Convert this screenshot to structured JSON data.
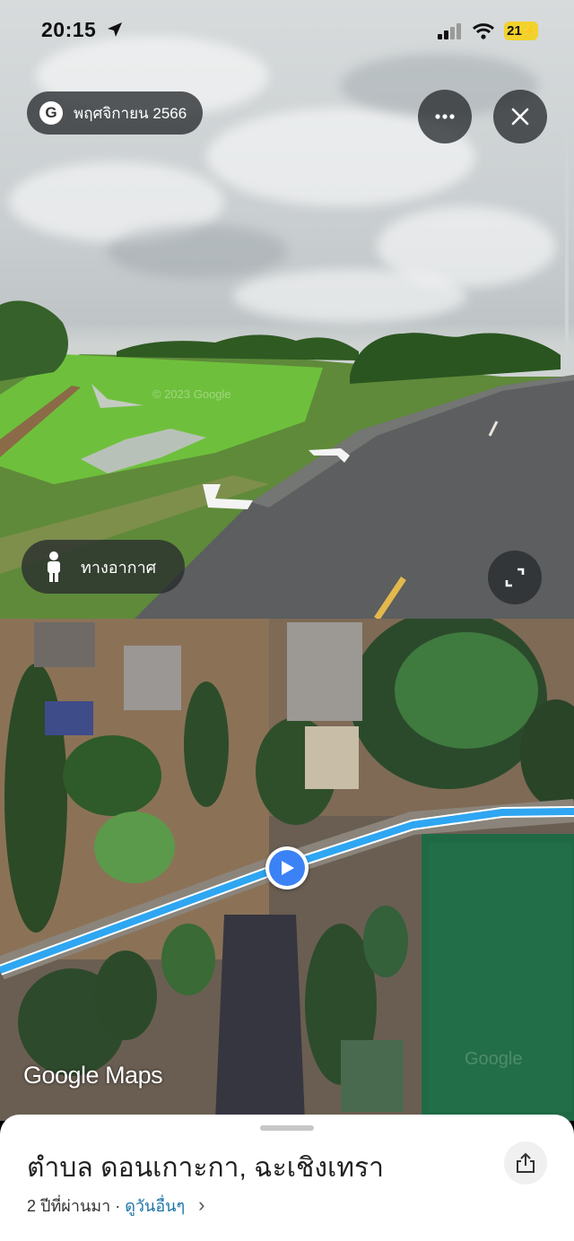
{
  "status_bar": {
    "time": "20:15",
    "battery": "21"
  },
  "street_view": {
    "date_label": "พฤศจิกายน 2566",
    "google_g": "G",
    "watermark": "© 2023 Google",
    "aerial_label": "ทางอากาศ",
    "more_icon": "more-icon",
    "close_icon": "close-icon",
    "expand_icon": "expand-icon"
  },
  "map": {
    "logo": "Google Maps",
    "faint_text": "Google"
  },
  "sheet": {
    "title": "ตำบล ดอนเกาะกา, ฉะเชิงเทรา",
    "age": "2 ปีที่ผ่านมา",
    "separator": " · ",
    "other_dates_link": "ดูวันอื่นๆ",
    "chevron": "›",
    "share_icon": "share-icon"
  },
  "colors": {
    "route": "#2ea6f2",
    "marker": "#3b82f6",
    "link": "#1a73a8"
  }
}
